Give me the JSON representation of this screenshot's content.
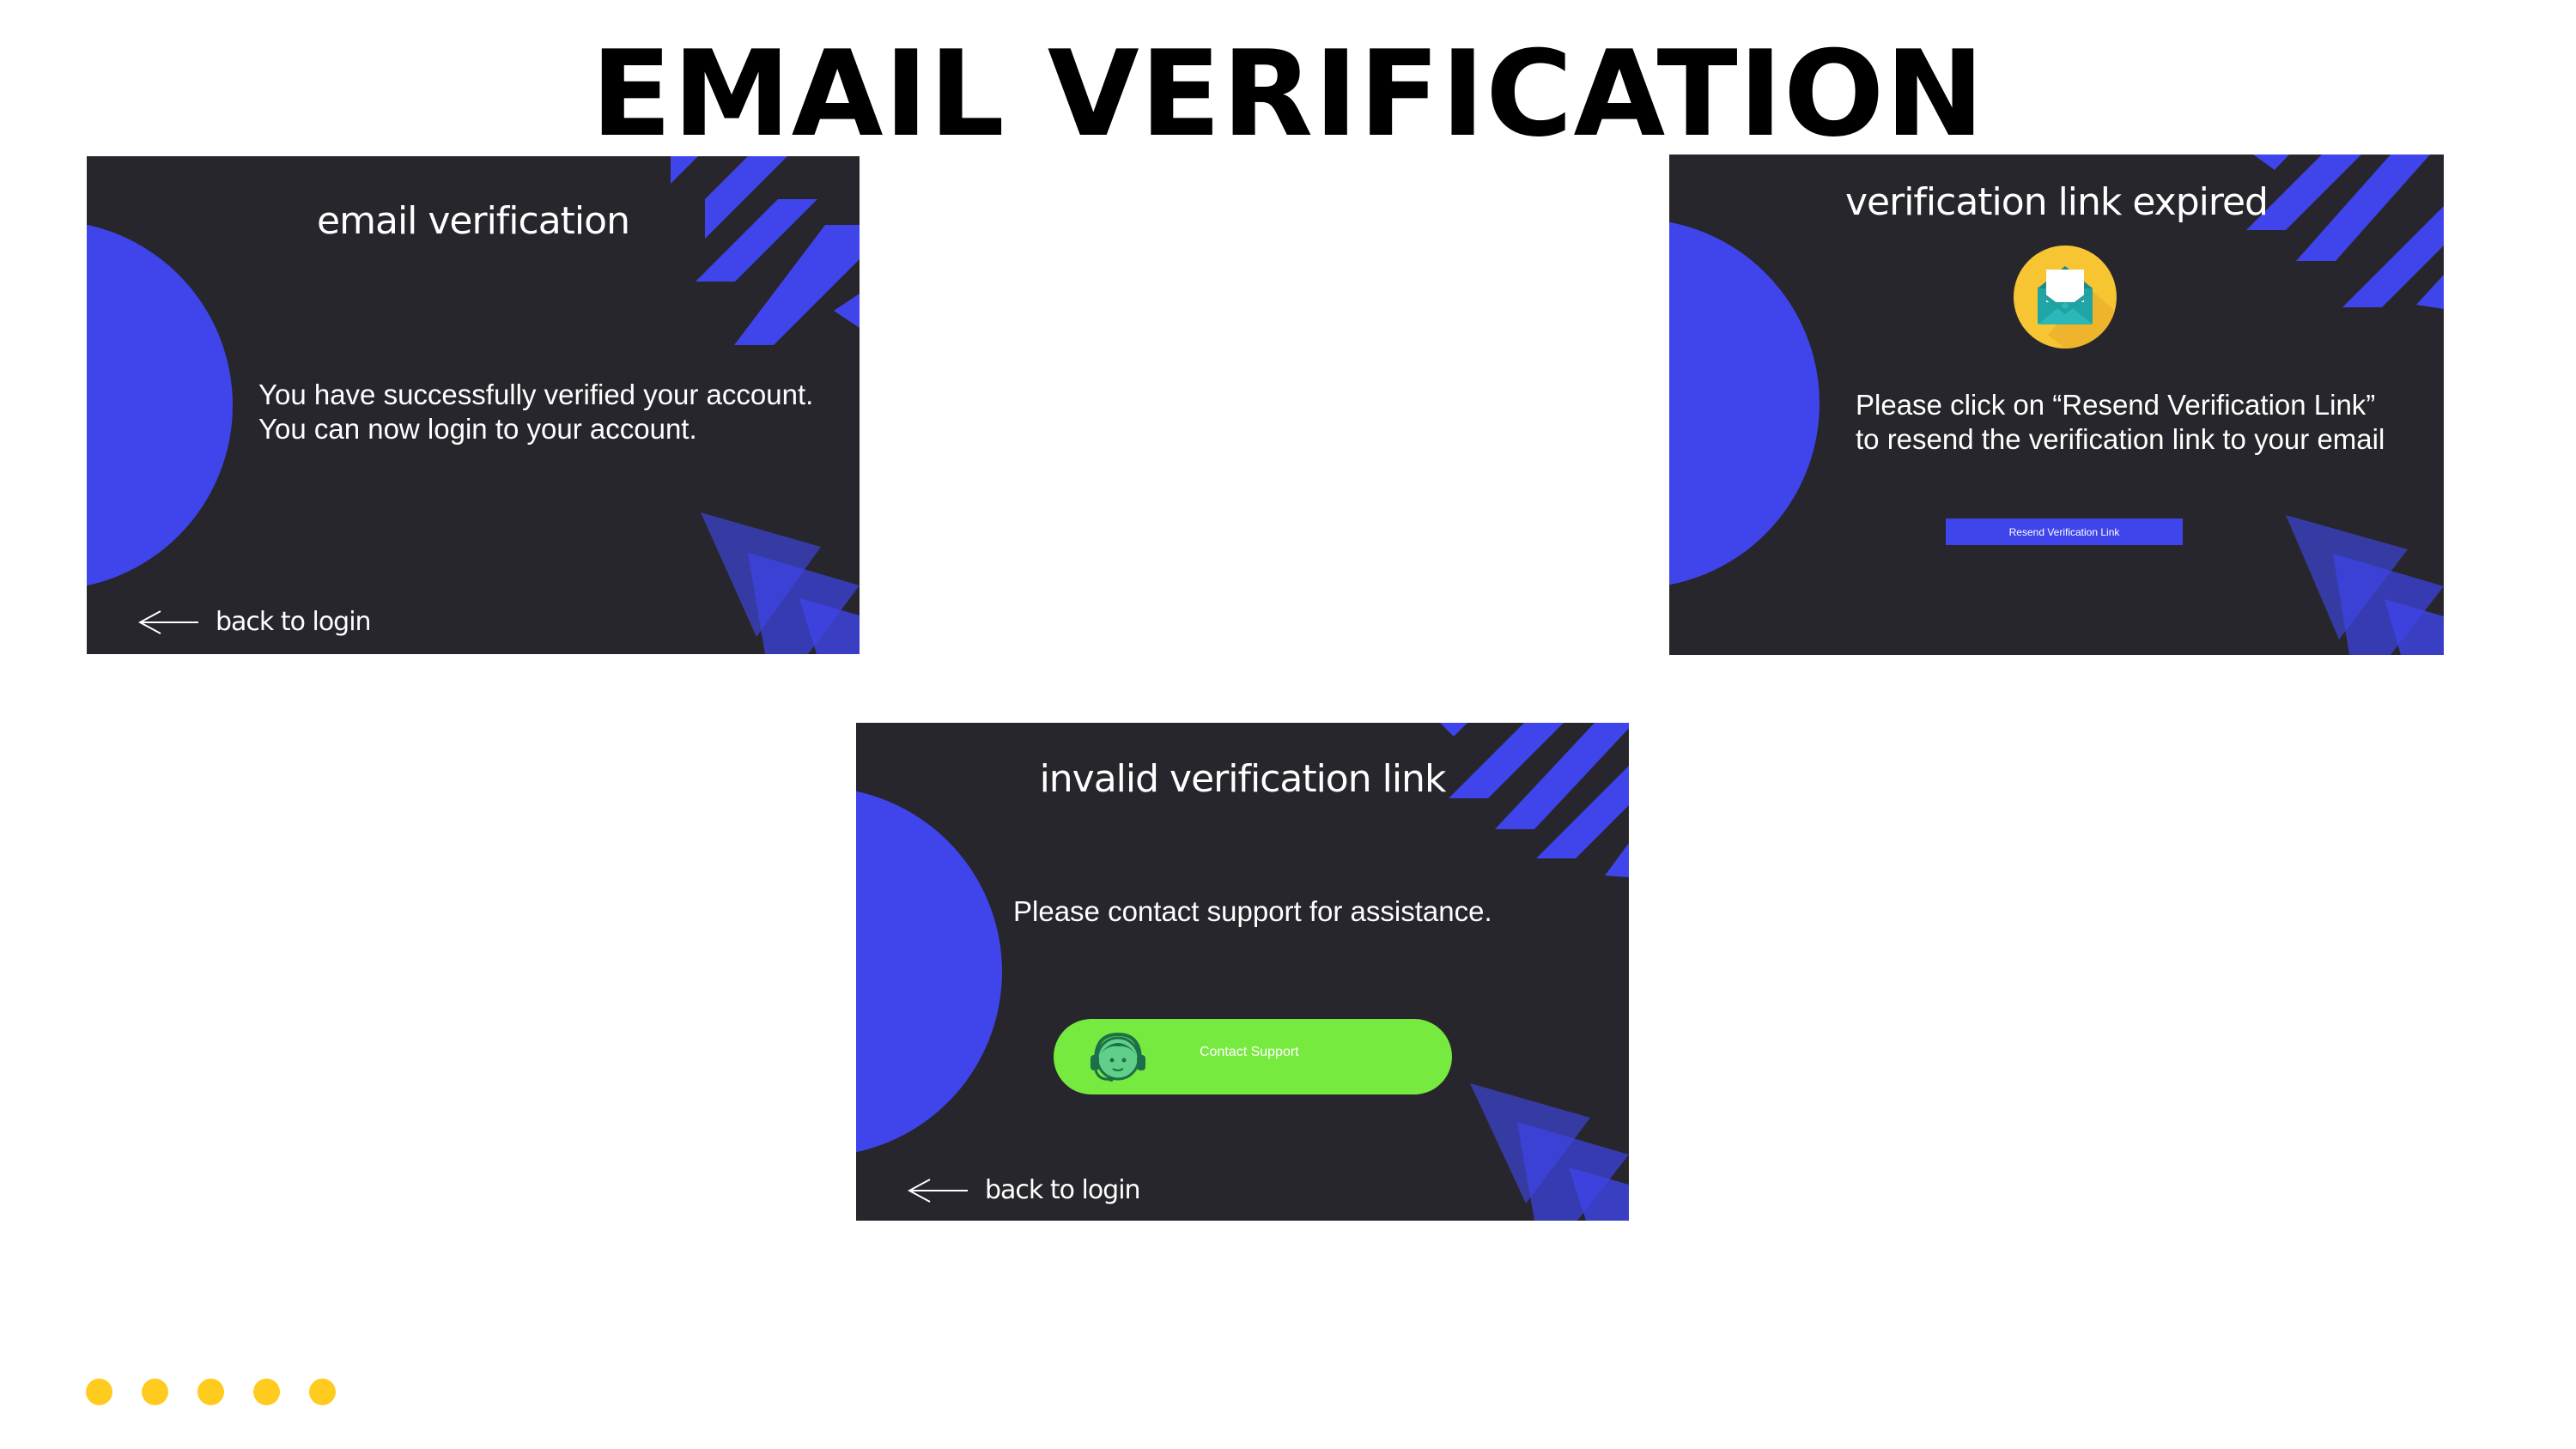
{
  "page": {
    "title": "EMAIL VERIFICATION"
  },
  "colors": {
    "card_background": "#27262c",
    "accent_blue": "#3f45ea",
    "support_green": "#77ea3f",
    "dot_yellow": "#ffcb1f"
  },
  "cards": {
    "success": {
      "title": "email verification",
      "line1": "You have successfully verified your account.",
      "line2": "You can now login to your account.",
      "back_label": "back to login"
    },
    "expired": {
      "title": "verification link expired",
      "icon": "envelope-icon",
      "line1": "Please click on “Resend Verification Link”",
      "line2": "to resend the verification link to your email",
      "button_label": "Resend Verification Link"
    },
    "invalid": {
      "title": "invalid verification link",
      "line1": "Please contact support for assistance.",
      "button_label": "Contact Support",
      "button_icon": "headset-support-icon",
      "back_label": "back to login"
    }
  },
  "footer": {
    "dots_count": 5
  }
}
